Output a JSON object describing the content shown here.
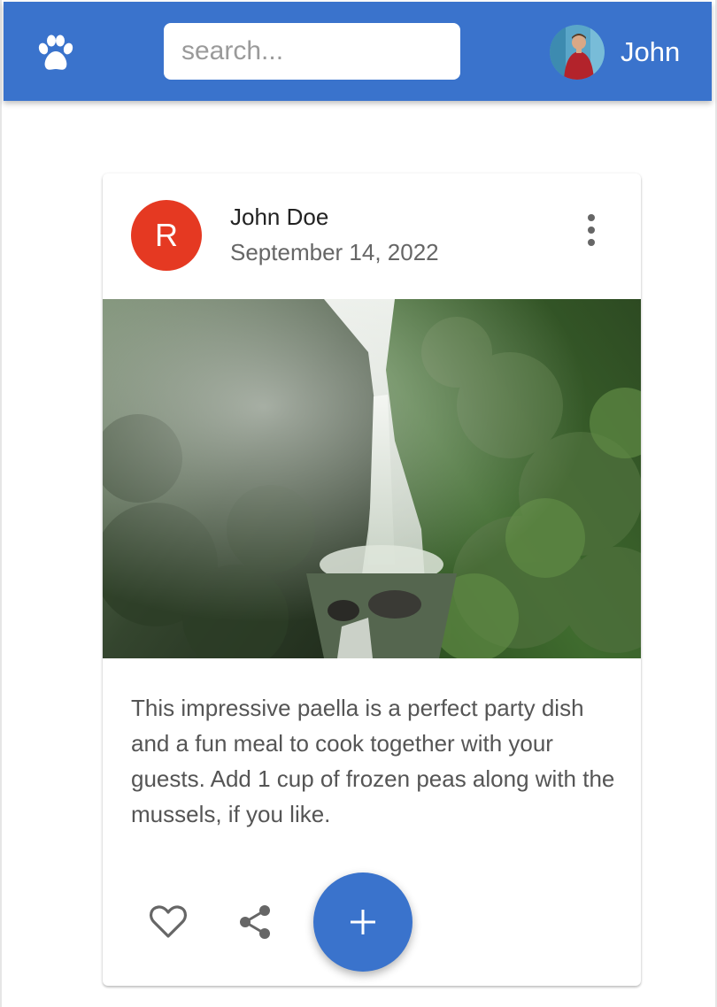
{
  "header": {
    "logo_icon": "paw-icon",
    "search_placeholder": "search...",
    "user_name": "John",
    "brand_color": "#3a73cc"
  },
  "post": {
    "avatar_letter": "R",
    "avatar_color": "#e53922",
    "author": "John Doe",
    "date": "September 14, 2022",
    "menu_icon": "more-vert-icon",
    "image_alt": "Waterfall in a green jungle",
    "text": "This impressive paella is a perfect party dish and a fun meal to cook together with your guests. Add 1 cup of frozen peas along with the mussels, if you like.",
    "actions": {
      "favorite_icon": "heart-icon",
      "share_icon": "share-icon",
      "add_icon": "plus-icon"
    }
  }
}
